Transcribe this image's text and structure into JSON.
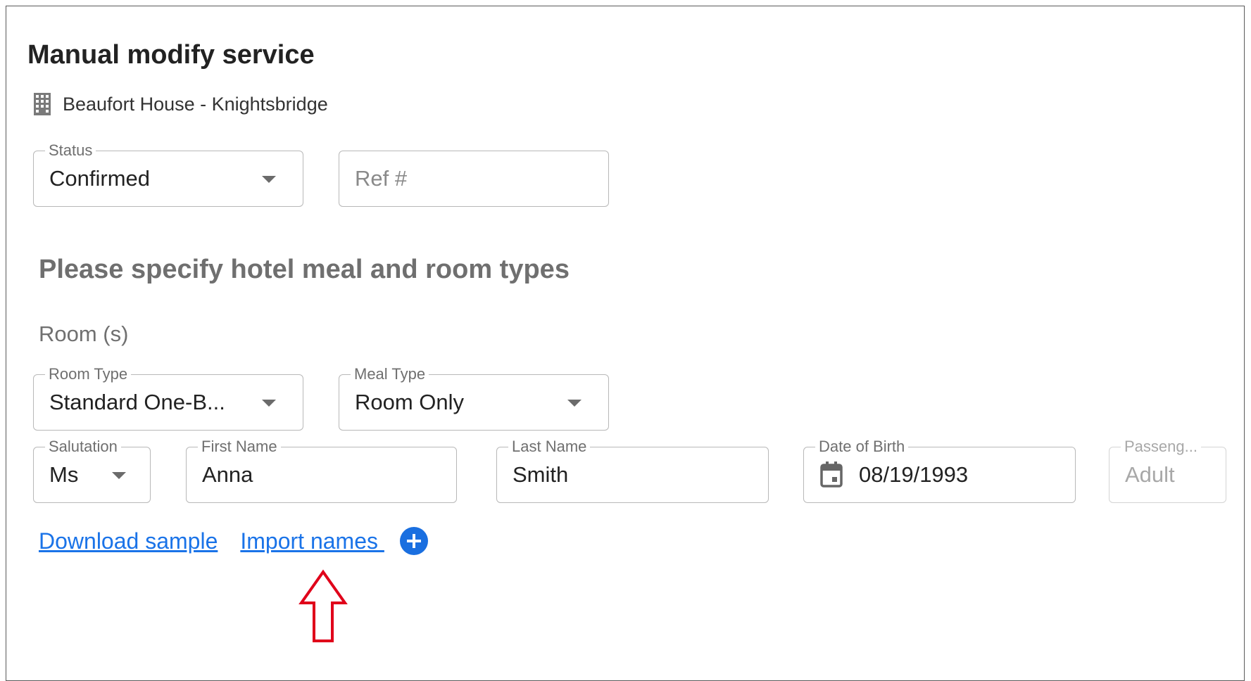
{
  "page": {
    "title": "Manual modify service",
    "hotel_name": "Beaufort House - Knightsbridge"
  },
  "status_field": {
    "label": "Status",
    "value": "Confirmed",
    "icon": "dropdown-caret"
  },
  "ref_field": {
    "placeholder": "Ref #"
  },
  "section_heading": "Please specify hotel meal and room types",
  "rooms_heading": "Room (s)",
  "room_type_field": {
    "label": "Room Type",
    "value": "Standard One-B...",
    "icon": "dropdown-caret"
  },
  "meal_type_field": {
    "label": "Meal Type",
    "value": "Room Only",
    "icon": "dropdown-caret"
  },
  "guest": {
    "salutation": {
      "label": "Salutation",
      "value": "Ms"
    },
    "first_name": {
      "label": "First Name",
      "value": "Anna"
    },
    "last_name": {
      "label": "Last Name",
      "value": "Smith"
    },
    "dob": {
      "label": "Date of Birth",
      "value": "08/19/1993",
      "icon": "calendar-icon"
    },
    "passenger_type": {
      "label": "Passeng...",
      "value": "Adult"
    }
  },
  "links": {
    "download_sample": "Download sample",
    "import_names": "Import names ",
    "add_icon": "plus-circle-icon"
  },
  "colors": {
    "link": "#1a73e8",
    "add_button": "#1a6fe0",
    "annotation_arrow": "#e0001a"
  }
}
